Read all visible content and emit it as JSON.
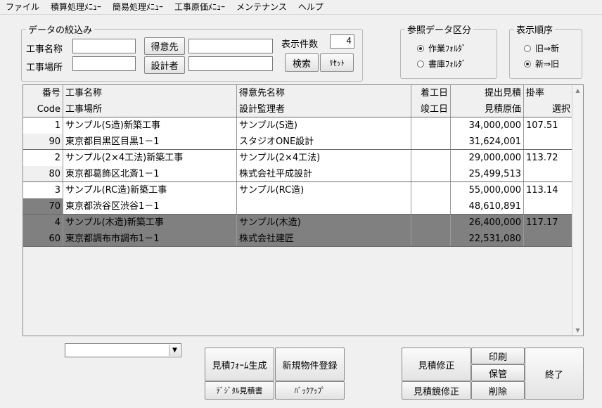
{
  "menu": [
    "ファイル",
    "積算処理ﾒﾆｭｰ",
    "簡易処理ﾒﾆｭｰ",
    "工事原価ﾒﾆｭｰ",
    "メンテナンス",
    "ヘルプ"
  ],
  "filter": {
    "legend": "データの絞込み",
    "name_label": "工事名称",
    "name_value": "",
    "place_label": "工事場所",
    "place_value": "",
    "client_button": "得意先",
    "client_value": "",
    "designer_button": "設計者",
    "designer_value": "",
    "count_label": "表示件数",
    "count_value": "4",
    "search_button": "検索",
    "reset_button": "ﾘｾｯﾄ"
  },
  "ref_data": {
    "legend": "参照データ区分",
    "options": [
      {
        "label": "作業ﾌｫﾙﾀﾞ",
        "selected": true
      },
      {
        "label": "書庫ﾌｫﾙﾀﾞ",
        "selected": false
      }
    ]
  },
  "order": {
    "legend": "表示順序",
    "options": [
      {
        "label": "旧⇒新",
        "selected": false
      },
      {
        "label": "新⇒旧",
        "selected": true
      }
    ]
  },
  "grid": {
    "header_top": [
      "番号",
      "工事名称",
      "得意先名称",
      "着工日",
      "提出見積",
      "掛率"
    ],
    "header_bottom": [
      "Code",
      "工事場所",
      "設計監理者",
      "竣工日",
      "見積原価",
      "選択"
    ],
    "rows": [
      {
        "no": "1",
        "code": "90",
        "name": "サンプル(S造)新築工事",
        "place": "東京都目黒区目黒1－1",
        "client": "サンプル(S造)",
        "designer": "スタジオONE設計",
        "start": "",
        "end": "",
        "estimate": "34,000,000",
        "cost": "31,624,001",
        "rate": "107.51",
        "select": "",
        "selected": false
      },
      {
        "no": "2",
        "code": "80",
        "name": "サンプル(2×4工法)新築工事",
        "place": "東京都葛飾区北斎1－1",
        "client": "サンプル(2×4工法)",
        "designer": "株式会社平成設計",
        "start": "",
        "end": "",
        "estimate": "29,000,000",
        "cost": "25,499,513",
        "rate": "113.72",
        "select": "",
        "selected": false
      },
      {
        "no": "3",
        "code": "70",
        "name": "サンプル(RC造)新築工事",
        "place": "東京都渋谷区渋谷1－1",
        "client": "サンプル(RC造)",
        "designer": "",
        "start": "",
        "end": "",
        "estimate": "55,000,000",
        "cost": "48,610,891",
        "rate": "113.14",
        "select": "",
        "selected": false
      },
      {
        "no": "4",
        "code": "60",
        "name": "サンプル(木造)新築工事",
        "place": "東京都調布市調布1－1",
        "client": "サンプル(木造)",
        "designer": "株式会社建匠",
        "start": "",
        "end": "",
        "estimate": "26,400,000",
        "cost": "22,531,080",
        "rate": "117.17",
        "select": "",
        "selected": true
      }
    ]
  },
  "combo_value": "",
  "buttons": {
    "form_gen": "見積ﾌｫｰﾑ生成",
    "new_register": "新規物件登録",
    "digital_est": "ﾃﾞｼﾞﾀﾙ見積書",
    "backup": "ﾊﾞｯｸｱｯﾌﾟ",
    "est_edit": "見積修正",
    "print": "印刷",
    "store": "保管",
    "mirror_edit": "見積鏡修正",
    "delete": "削除",
    "exit": "終了"
  },
  "colors": {
    "selected_row": "#808080",
    "code_highlight": "#808080",
    "cell_bg": "#ffffff",
    "header_bg": "#f0f0f0"
  }
}
